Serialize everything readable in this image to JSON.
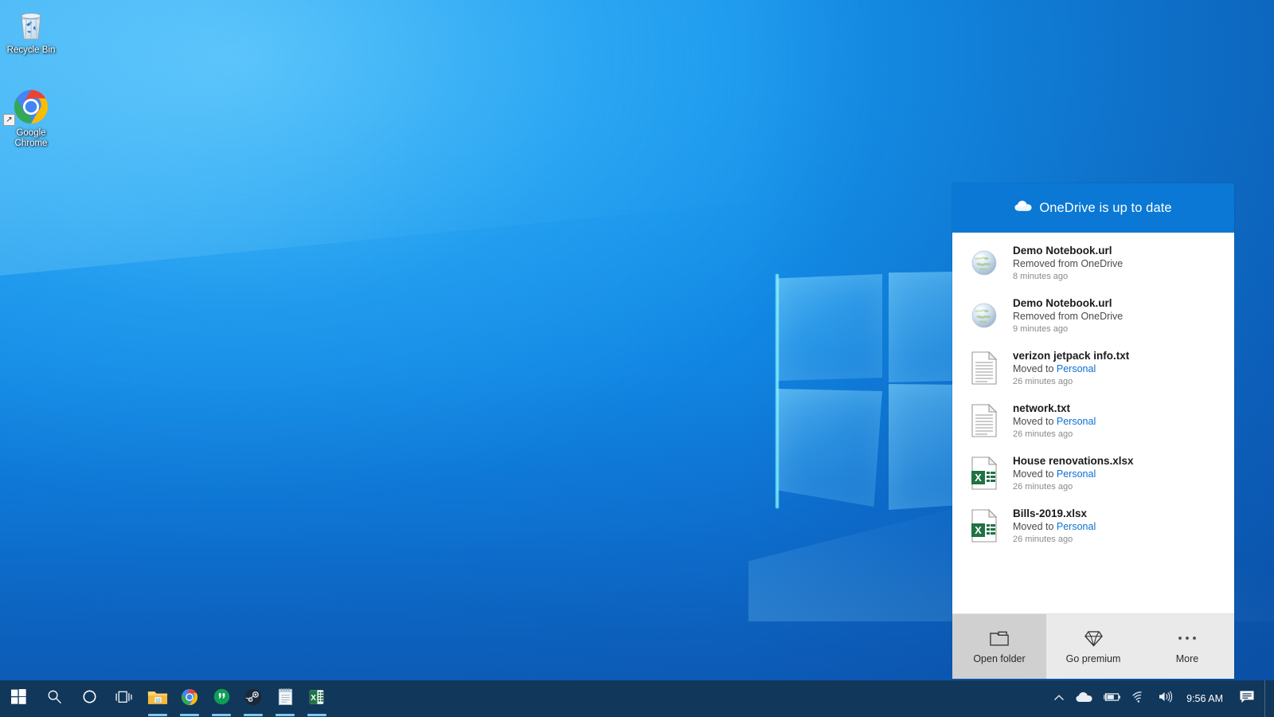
{
  "desktop": {
    "icons": [
      {
        "label": "Recycle Bin",
        "icon": "recycle-bin-icon"
      },
      {
        "label": "Google Chrome",
        "icon": "google-chrome-icon"
      }
    ]
  },
  "onedrive_panel": {
    "header": {
      "title": "OneDrive is up to date",
      "icon": "onedrive-cloud-icon"
    },
    "items": [
      {
        "name": "Demo Notebook.url",
        "status_prefix": "Removed from OneDrive",
        "status_link": "",
        "time": "8 minutes ago",
        "icon": "internet-shortcut-icon"
      },
      {
        "name": "Demo Notebook.url",
        "status_prefix": "Removed from OneDrive",
        "status_link": "",
        "time": "9 minutes ago",
        "icon": "internet-shortcut-icon"
      },
      {
        "name": "verizon jetpack info.txt",
        "status_prefix": "Moved to ",
        "status_link": "Personal",
        "time": "26 minutes ago",
        "icon": "text-file-icon"
      },
      {
        "name": "network.txt",
        "status_prefix": "Moved to ",
        "status_link": "Personal",
        "time": "26 minutes ago",
        "icon": "text-file-icon"
      },
      {
        "name": "House renovations.xlsx",
        "status_prefix": "Moved to ",
        "status_link": "Personal",
        "time": "26 minutes ago",
        "icon": "excel-file-icon"
      },
      {
        "name": "Bills-2019.xlsx",
        "status_prefix": "Moved to ",
        "status_link": "Personal",
        "time": "26 minutes ago",
        "icon": "excel-file-icon"
      }
    ],
    "footer": {
      "buttons": [
        {
          "label": "Open folder",
          "icon": "folder-icon"
        },
        {
          "label": "Go premium",
          "icon": "diamond-icon"
        },
        {
          "label": "More",
          "icon": "ellipsis-icon"
        }
      ]
    }
  },
  "taskbar": {
    "start": {
      "icon": "windows-start-icon"
    },
    "search": {
      "icon": "search-icon"
    },
    "cortana": {
      "icon": "cortana-icon"
    },
    "task_view": {
      "icon": "task-view-icon"
    },
    "apps": [
      {
        "name": "File Explorer",
        "icon": "file-explorer-icon",
        "running": true
      },
      {
        "name": "Google Chrome",
        "icon": "chrome-icon",
        "running": true
      },
      {
        "name": "Hangouts",
        "icon": "hangouts-icon",
        "running": true
      },
      {
        "name": "Steam",
        "icon": "steam-icon",
        "running": true
      },
      {
        "name": "Notepad",
        "icon": "notepad-icon",
        "running": true
      },
      {
        "name": "Excel",
        "icon": "excel-icon",
        "running": true
      }
    ],
    "tray": [
      {
        "name": "show-hidden-icons",
        "icon": "chevron-up-icon"
      },
      {
        "name": "onedrive",
        "icon": "onedrive-tray-icon"
      },
      {
        "name": "battery",
        "icon": "battery-charging-icon"
      },
      {
        "name": "network",
        "icon": "wifi-icon"
      },
      {
        "name": "volume",
        "icon": "speaker-icon"
      }
    ],
    "clock": {
      "time": "9:56 AM"
    },
    "action_center": {
      "icon": "action-center-icon"
    }
  },
  "colors": {
    "accent_blue": "#0a78d4",
    "taskbar": "#11375b",
    "link": "#0b72d0",
    "excel_green": "#1f7244",
    "footer_bg": "#eaeaea"
  }
}
